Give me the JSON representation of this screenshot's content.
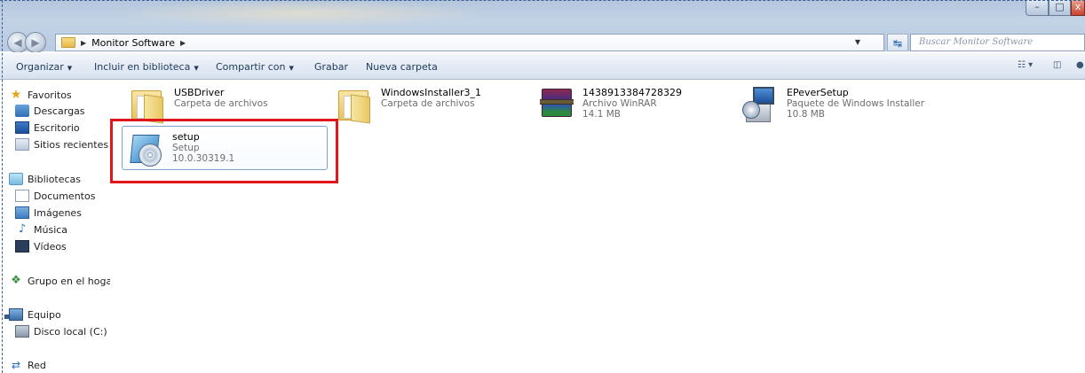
{
  "address": {
    "crumbs": [
      "Monitor Software"
    ],
    "search_placeholder": "Buscar Monitor Software"
  },
  "window_controls": {
    "minimize_icon": "minimize-icon",
    "maximize_icon": "maximize-icon",
    "close_icon": "close-icon"
  },
  "toolbar": {
    "organize": "Organizar",
    "include_library": "Incluir en biblioteca",
    "share_with": "Compartir con",
    "burn": "Grabar",
    "new_folder": "Nueva carpeta"
  },
  "nav": {
    "favorites": "Favoritos",
    "downloads": "Descargas",
    "desktop": "Escritorio",
    "recent": "Sitios recientes",
    "libraries": "Bibliotecas",
    "documents": "Documentos",
    "images": "Imágenes",
    "music": "Música",
    "videos": "Vídeos",
    "homegroup": "Grupo en el hogar",
    "computer": "Equipo",
    "local_disk": "Disco local (C:)",
    "network": "Red"
  },
  "files": [
    {
      "name": "USBDriver",
      "type": "Carpeta de archivos",
      "detail": ""
    },
    {
      "name": "WindowsInstaller3_1",
      "type": "Carpeta de archivos",
      "detail": ""
    },
    {
      "name": "1438913384728329",
      "type": "Archivo WinRAR",
      "detail": "14.1 MB"
    },
    {
      "name": "EPeverSetup",
      "type": "Paquete de Windows Installer",
      "detail": "10.8 MB"
    },
    {
      "name": "setup",
      "type": "Setup",
      "detail": "10.0.30319.1"
    }
  ],
  "colors": {
    "highlight": "#e0161b",
    "selection_border": "#7da2ce"
  }
}
